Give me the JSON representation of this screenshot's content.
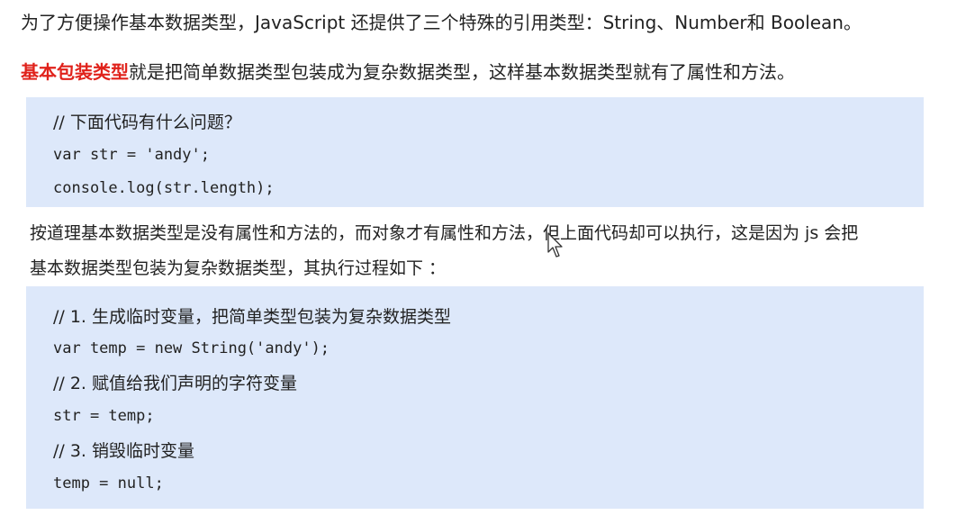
{
  "intro": {
    "line1": "为了方便操作基本数据类型，JavaScript 还提供了三个特殊的引用类型：String、Number和 Boolean。",
    "term": "基本包装类型",
    "line2_rest": "就是把简单数据类型包装成为复杂数据类型，这样基本数据类型就有了属性和方法。"
  },
  "code_block_1": {
    "comment": "// 下面代码有什么问题？",
    "line1": "var str = 'andy';",
    "line2": "console.log(str.length);"
  },
  "explanation": {
    "line1": "按道理基本数据类型是没有属性和方法的，而对象才有属性和方法，但上面代码却可以执行，这是因为 js 会把",
    "line2": "基本数据类型包装为复杂数据类型，其执行过程如下 ："
  },
  "code_block_2": {
    "comment1": "// 1. 生成临时变量，把简单类型包装为复杂数据类型",
    "code1": "var temp = new String('andy');",
    "comment2": "// 2. 赋值给我们声明的字符变量",
    "code2": "str = temp;",
    "comment3": "// 3. 销毁临时变量",
    "code3": "temp = null;"
  },
  "colors": {
    "highlight": "#e0221b",
    "code_background": "#dde8fa",
    "text": "#222222"
  }
}
